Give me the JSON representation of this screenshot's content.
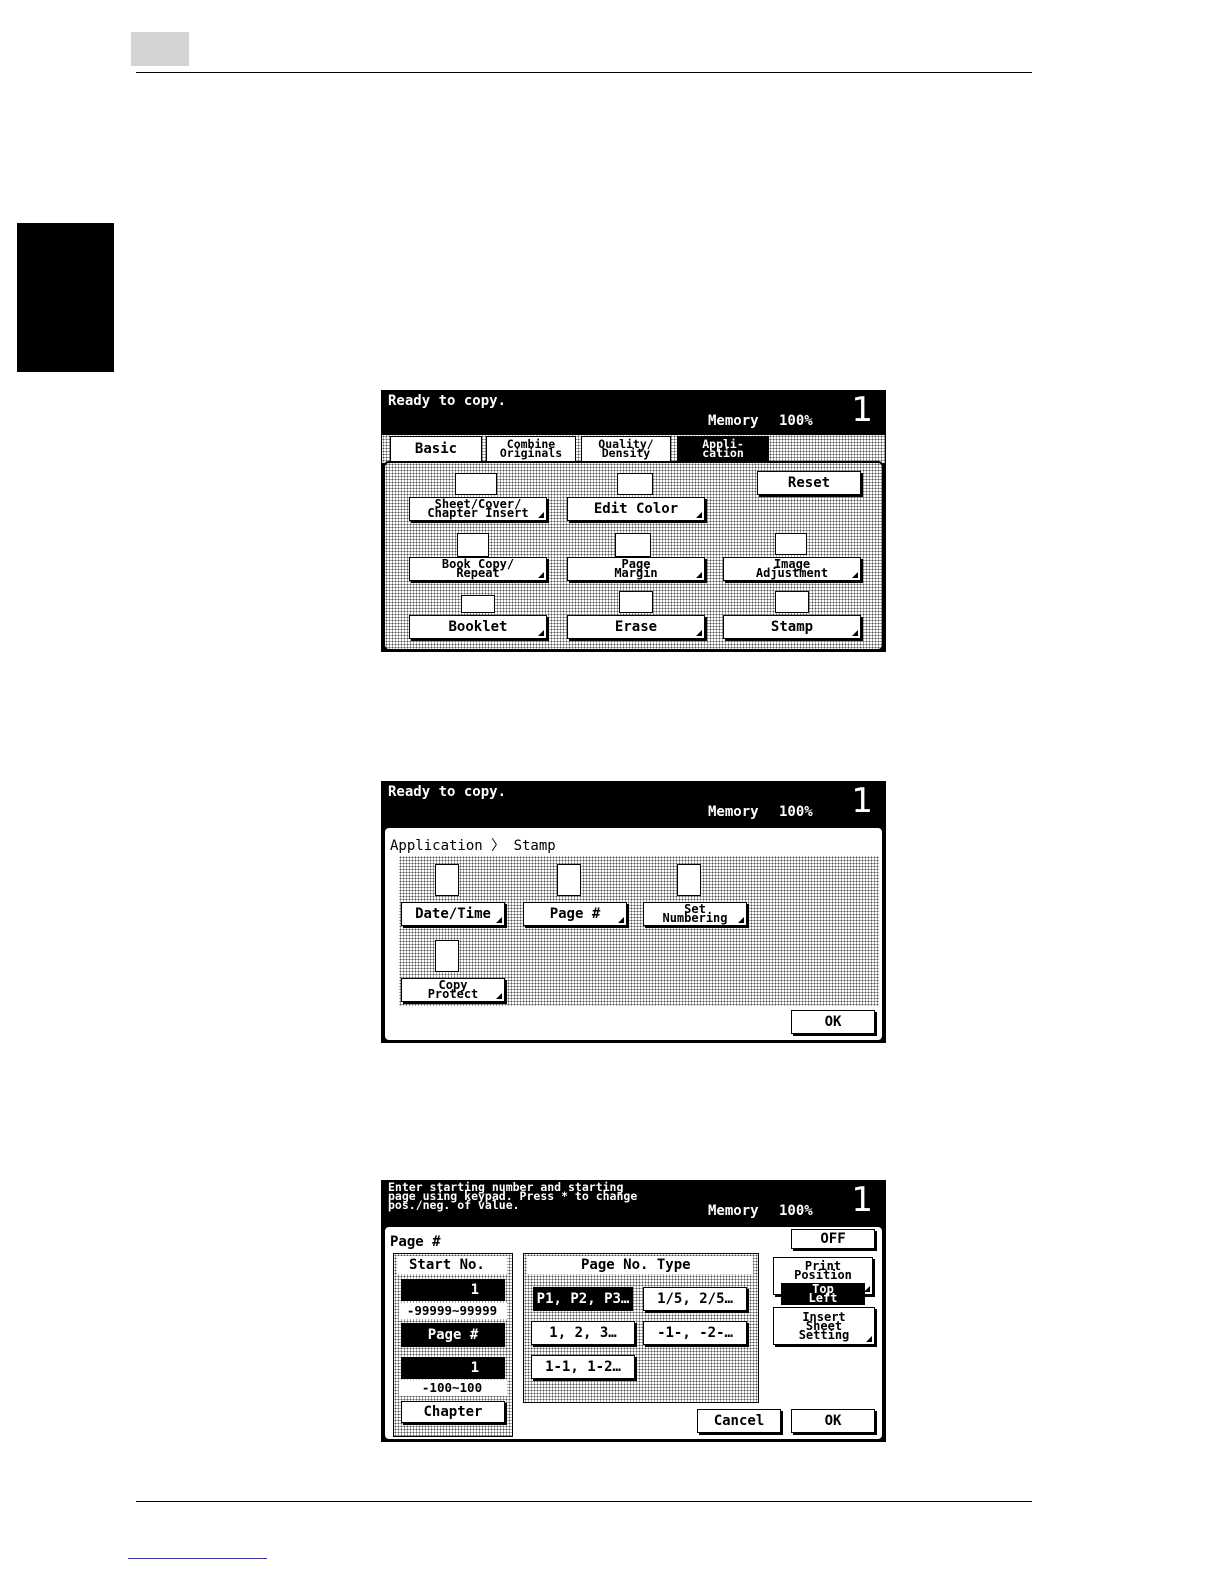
{
  "screen1": {
    "status": "Ready to copy.",
    "memory_label": "Memory",
    "memory_value": "100%",
    "copies": "1",
    "tabs": [
      {
        "label": "Basic"
      },
      {
        "label": "Combine\nOriginals"
      },
      {
        "label": "Quality/\nDensity"
      },
      {
        "label": "Appli-\ncation"
      }
    ],
    "buttons": {
      "sheet_cover": "Sheet/Cover/\nChapter Insert",
      "edit_color": "Edit Color",
      "reset": "Reset",
      "book_copy": "Book Copy/\nRepeat",
      "page_margin": "Page\nMargin",
      "image_adjustment": "Image\nAdjustment",
      "booklet": "Booklet",
      "erase": "Erase",
      "stamp": "Stamp"
    }
  },
  "screen2": {
    "status": "Ready to copy.",
    "memory_label": "Memory",
    "memory_value": "100%",
    "copies": "1",
    "breadcrumb": "Application 〉 Stamp",
    "buttons": {
      "date_time": "Date/Time",
      "page_num": "Page #",
      "set_numbering": "Set\nNumbering",
      "copy_protect": "Copy\nProtect",
      "ok": "OK"
    }
  },
  "screen3": {
    "status": "Enter starting number and starting\npage using keypad. Press * to change\npos./neg. of value.",
    "memory_label": "Memory",
    "memory_value": "100%",
    "copies": "1",
    "title": "Page #",
    "start_no_label": "Start No.",
    "start_value": "1",
    "start_range": "-99999~99999",
    "page_num_btn": "Page #",
    "chapter_value": "1",
    "chapter_range": "-100~100",
    "chapter_btn": "Chapter",
    "page_type_label": "Page No. Type",
    "types": {
      "t1": "P1, P2, P3…",
      "t2": "1/5, 2/5…",
      "t3": "1, 2, 3…",
      "t4": "-1-, -2-…",
      "t5": "1-1, 1-2…"
    },
    "off": "OFF",
    "print_position": "Print\nPosition",
    "print_position_value": "Top\nLeft",
    "insert_sheet": "Insert\nSheet\nSetting",
    "cancel": "Cancel",
    "ok": "OK"
  }
}
